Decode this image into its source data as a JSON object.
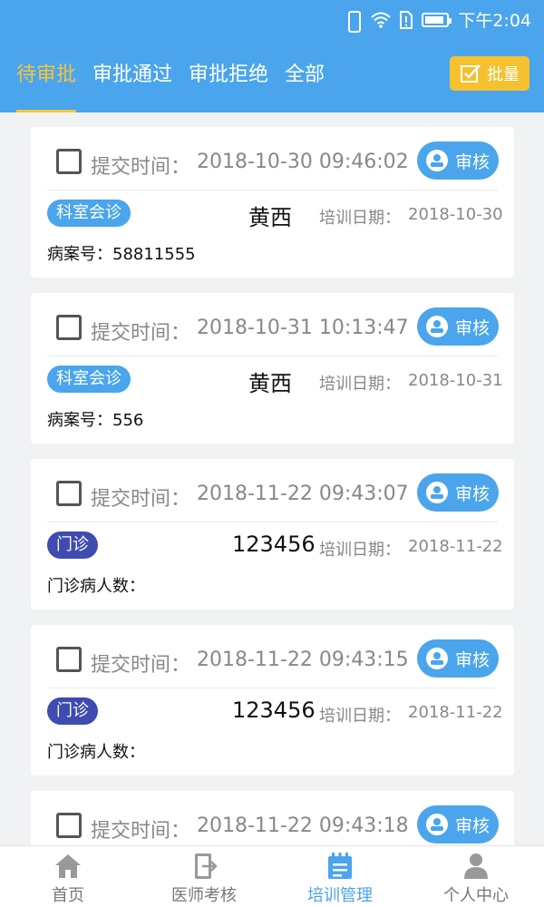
{
  "status_bar": {
    "time": "下午2:04"
  },
  "tabs": [
    {
      "label": "待审批",
      "active": true
    },
    {
      "label": "审批通过",
      "active": false
    },
    {
      "label": "审批拒绝",
      "active": false
    },
    {
      "label": "全部",
      "active": false
    }
  ],
  "batch_button": {
    "label": "批量"
  },
  "card_labels": {
    "submit_time": "提交时间：",
    "review": "审核",
    "train_date": "培训日期："
  },
  "records": [
    {
      "submit_time": "2018-10-30 09:46:02",
      "tag": "科室会诊",
      "name": "黄西",
      "train_date": "2018-10-30",
      "extra_label": "病案号：",
      "extra_value": "58811555"
    },
    {
      "submit_time": "2018-10-31 10:13:47",
      "tag": "科室会诊",
      "name": "黄西",
      "train_date": "2018-10-31",
      "extra_label": "病案号：",
      "extra_value": "556"
    },
    {
      "submit_time": "2018-11-22 09:43:07",
      "tag": "门诊",
      "name": "123456",
      "train_date": "2018-11-22",
      "extra_label": "门诊病人数：",
      "extra_value": ""
    },
    {
      "submit_time": "2018-11-22 09:43:15",
      "tag": "门诊",
      "name": "123456",
      "train_date": "2018-11-22",
      "extra_label": "门诊病人数：",
      "extra_value": ""
    },
    {
      "submit_time": "2018-11-22 09:43:18",
      "tag": "",
      "name": "",
      "train_date": "",
      "extra_label": "",
      "extra_value": ""
    }
  ],
  "bottom_nav": [
    {
      "label": "首页",
      "icon": "home-icon",
      "active": false
    },
    {
      "label": "医师考核",
      "icon": "exam-icon",
      "active": false
    },
    {
      "label": "培训管理",
      "icon": "training-icon",
      "active": true
    },
    {
      "label": "个人中心",
      "icon": "user-icon",
      "active": false
    }
  ],
  "colors": {
    "primary": "#4aa5ec",
    "accent": "#f7c43a",
    "clinic_tag": "#3e4bb0"
  }
}
